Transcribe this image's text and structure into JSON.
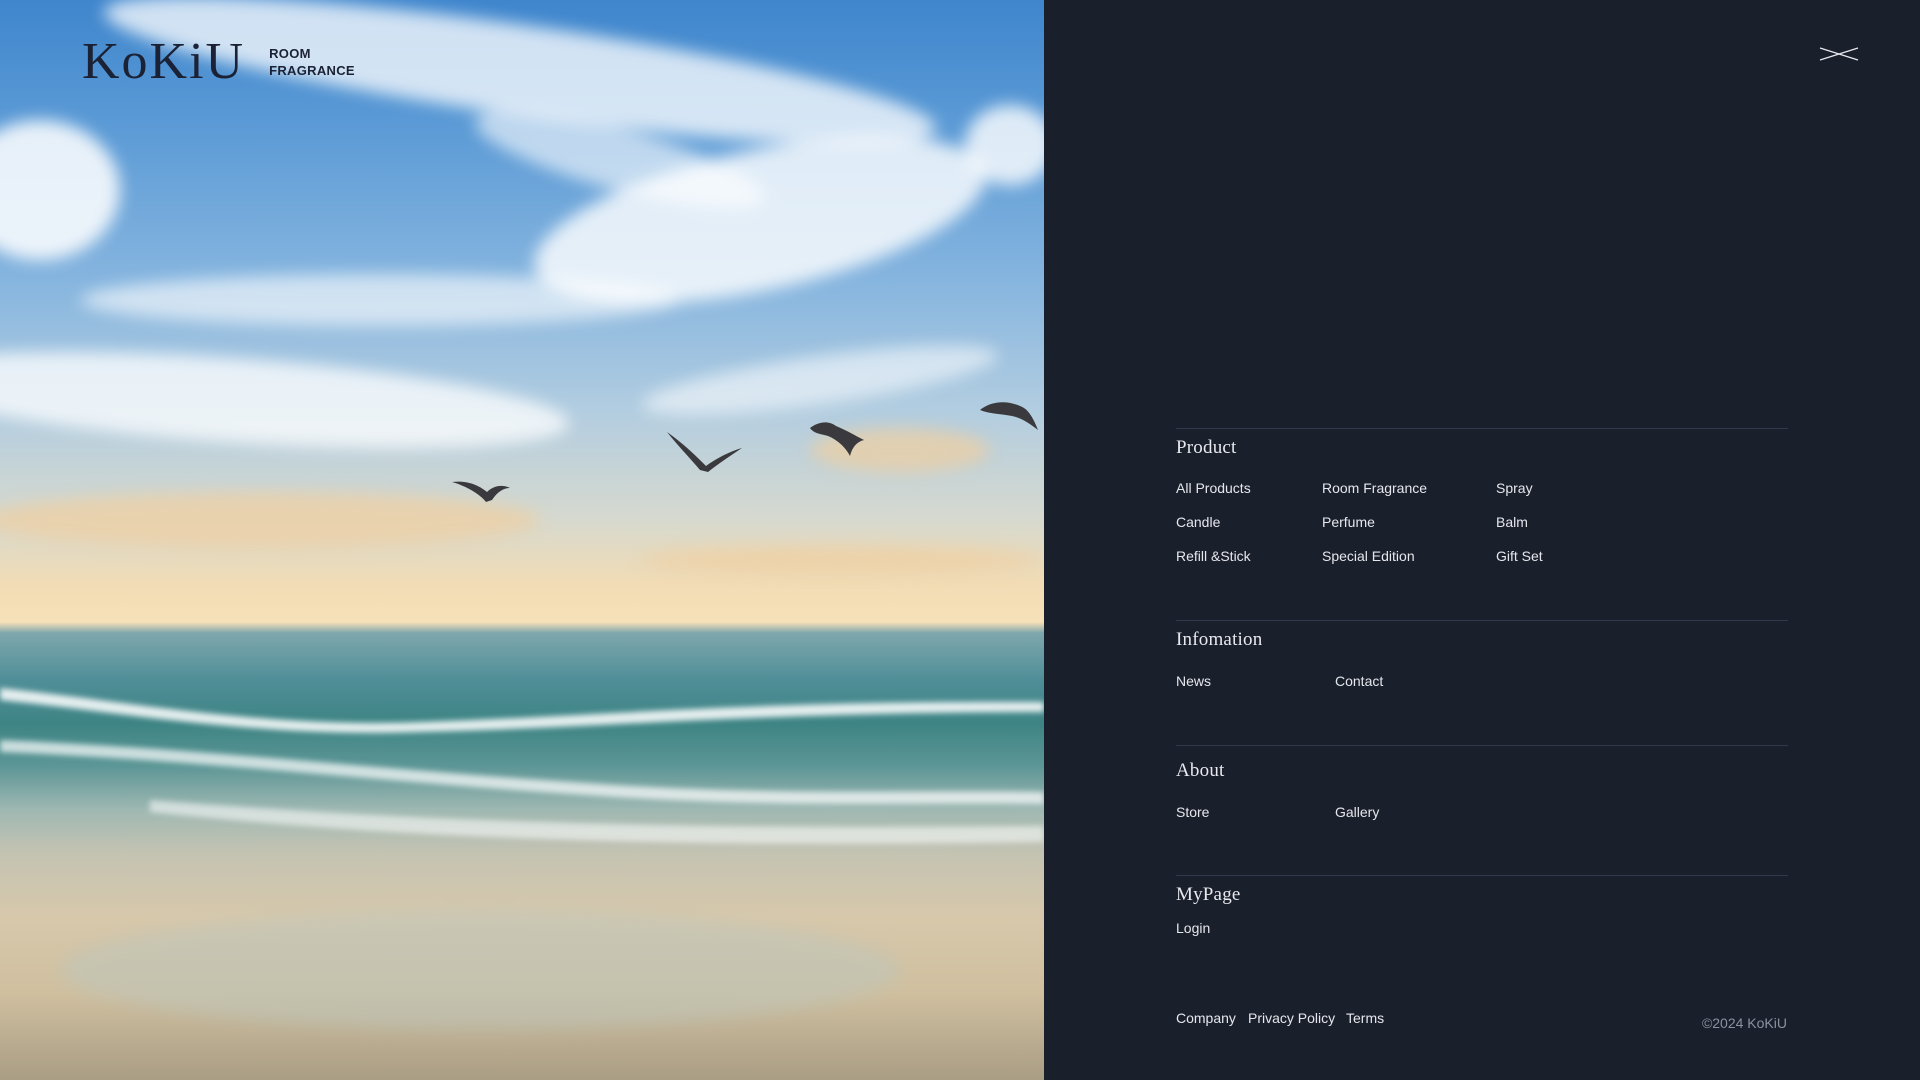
{
  "brand": {
    "logo_text": "KoKiU",
    "tagline_line1": "ROOM",
    "tagline_line2": "FRAGRANCE"
  },
  "close_icon": "close-x-icon",
  "hero_image": "seagulls-flying-over-beach-at-sunset",
  "menu": {
    "product": {
      "title": "Product",
      "items": [
        "All Products",
        "Room Fragrance",
        "Spray",
        "Candle",
        "Perfume",
        "Balm",
        "Refill &Stick",
        "Special Edition",
        "Gift Set"
      ]
    },
    "information": {
      "title": "Infomation",
      "items": [
        "News",
        "Contact"
      ]
    },
    "about": {
      "title": "About",
      "items": [
        "Store",
        "Gallery"
      ]
    },
    "mypage": {
      "title": "MyPage",
      "items": [
        "Login"
      ]
    }
  },
  "footer": {
    "links": [
      "Company",
      "Privacy Policy",
      "Terms"
    ],
    "copyright": "©2024 KoKiU"
  },
  "colors": {
    "panel_background": "#1a1f2c",
    "divider": "#323849",
    "text": "#e6e7ec",
    "logo": "#1b2236"
  }
}
